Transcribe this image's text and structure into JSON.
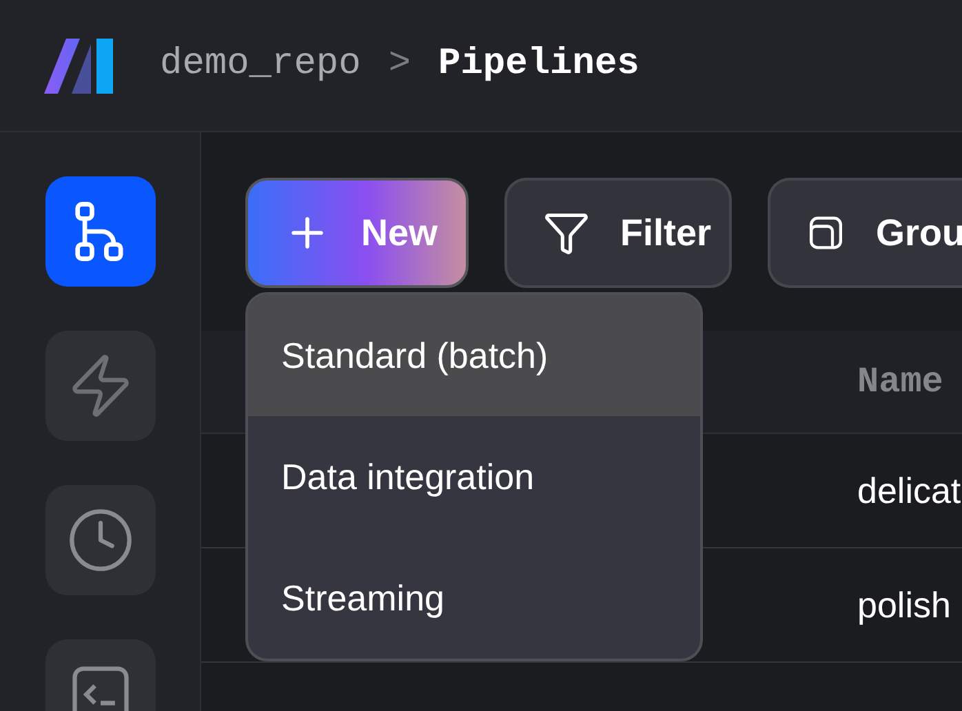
{
  "breadcrumb": {
    "repo": "demo_repo",
    "separator": ">",
    "page": "Pipelines"
  },
  "sidebar": {
    "items": [
      {
        "selected": true
      },
      {
        "selected": false
      },
      {
        "selected": false
      },
      {
        "selected": false
      }
    ]
  },
  "toolbar": {
    "buttons": [
      {
        "kind": "new",
        "label": "New"
      },
      {
        "kind": "filter",
        "label": "Filter"
      },
      {
        "kind": "group",
        "label": "Grou"
      }
    ]
  },
  "new_menu": {
    "items": [
      {
        "label": "Standard (batch)",
        "selected": true
      },
      {
        "label": "Data integration",
        "selected": false
      },
      {
        "label": "Streaming",
        "selected": false
      }
    ]
  },
  "table": {
    "columns": [
      "Name"
    ],
    "rows": [
      {
        "name": "delicat"
      },
      {
        "name": "polish"
      }
    ]
  }
}
